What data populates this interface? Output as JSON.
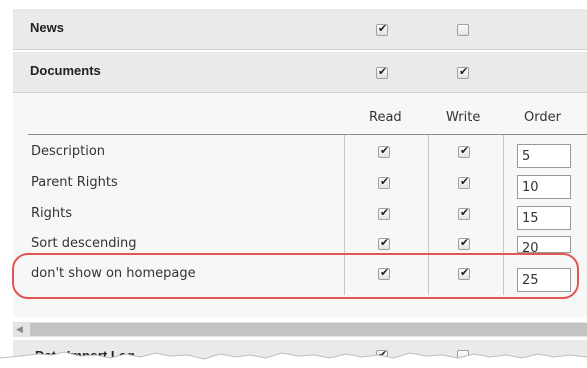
{
  "sections": [
    {
      "label": "News",
      "read_checked": true,
      "write_checked": false
    },
    {
      "label": "Documents",
      "read_checked": true,
      "write_checked": true
    }
  ],
  "columns": {
    "read": "Read",
    "write": "Write",
    "order": "Order"
  },
  "fields": [
    {
      "label": "Description",
      "read": true,
      "write": true,
      "order": "5"
    },
    {
      "label": "Parent Rights",
      "read": true,
      "write": true,
      "order": "10"
    },
    {
      "label": "Rights",
      "read": true,
      "write": true,
      "order": "15"
    },
    {
      "label": "Sort descending",
      "read": true,
      "write": true,
      "order": "20"
    },
    {
      "label": "don't show on homepage",
      "read": true,
      "write": true,
      "order": "25"
    }
  ],
  "next_section": {
    "label": "Data Import Log"
  },
  "colors": {
    "highlight": "#e25555",
    "section_bg": "#eaeaea",
    "panel_bg": "#f7f7f7"
  }
}
